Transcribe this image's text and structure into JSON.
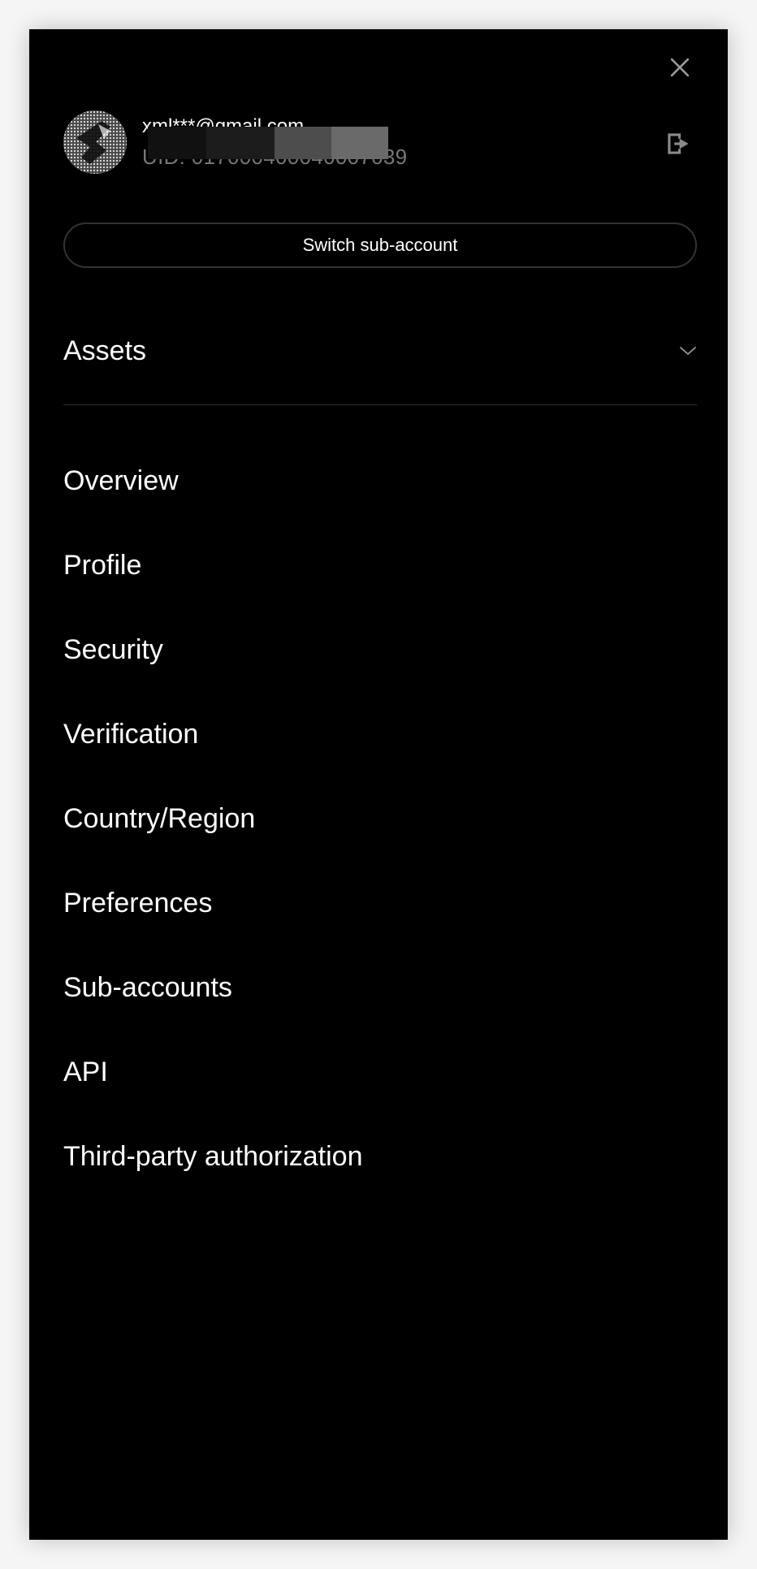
{
  "user": {
    "email": "xml***@gmail.com",
    "uid": "UID: 017000400040007039"
  },
  "actions": {
    "switch_label": "Switch sub-account"
  },
  "assets": {
    "label": "Assets"
  },
  "menu": {
    "items": [
      {
        "label": "Overview"
      },
      {
        "label": "Profile"
      },
      {
        "label": "Security"
      },
      {
        "label": "Verification"
      },
      {
        "label": "Country/Region"
      },
      {
        "label": "Preferences"
      },
      {
        "label": "Sub-accounts"
      },
      {
        "label": "API"
      },
      {
        "label": "Third-party authorization"
      }
    ]
  },
  "icons": {
    "close": "close-icon",
    "logout": "logout-icon",
    "chevron": "chevron-down-icon",
    "avatar": "avatar"
  },
  "colors": {
    "panel_background": "#000000",
    "page_background": "#f5f5f5",
    "muted_text": "#777777",
    "border": "#333333"
  }
}
